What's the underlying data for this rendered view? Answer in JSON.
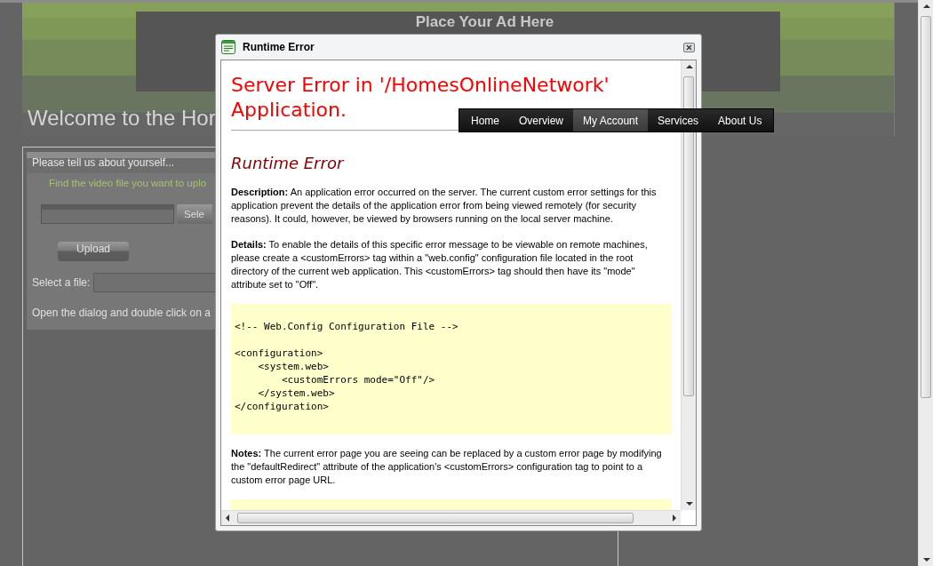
{
  "page": {
    "ad_text": "Place Your Ad Here",
    "welcome": "Welcome to the Hor",
    "form": {
      "title": "Please tell us about yourself...",
      "prompt": "Find the video file you want to uplo",
      "select_button": "Sele",
      "upload_button": "Upload",
      "file_label": "Select a file:",
      "hint": "Open the dialog and double click on a"
    }
  },
  "nav": [
    {
      "label": "Home",
      "selected": false
    },
    {
      "label": "Overview",
      "selected": false
    },
    {
      "label": "My Account",
      "selected": true
    },
    {
      "label": "Services",
      "selected": false
    },
    {
      "label": "About Us",
      "selected": false
    }
  ],
  "dialog": {
    "title": "Runtime Error",
    "heading": "Server Error in '/HomesOnlineNetwork' Application.",
    "subheading": "Runtime Error",
    "sections": [
      {
        "kind": "text",
        "text": "**Description:** An application error occurred on the server. The current custom error settings for this application prevent the details of the application error from being viewed remotely (for security reasons). It could, however, be viewed by browsers running on the local server machine."
      },
      {
        "kind": "text",
        "text": "**Details:** To enable the details of this specific error message to be viewable on remote machines, please create a <customErrors> tag within a \"web.config\" configuration file located in the root directory of the current web application. This <customErrors> tag should then have its \"mode\" attribute set to \"Off\"."
      },
      {
        "kind": "code",
        "header": "<!-- Web.Config Configuration File -->",
        "lines": [
          "<configuration>",
          "    <system.web>",
          "        <customErrors mode=\"Off\"/>",
          "    </system.web>",
          "</configuration>"
        ]
      },
      {
        "kind": "text",
        "text": "**Notes:** The current error page you are seeing can be replaced by a custom error page by modifying the \"defaultRedirect\" attribute of the application's <customErrors> configuration tag to point to a custom error page URL."
      },
      {
        "kind": "panel"
      }
    ]
  }
}
